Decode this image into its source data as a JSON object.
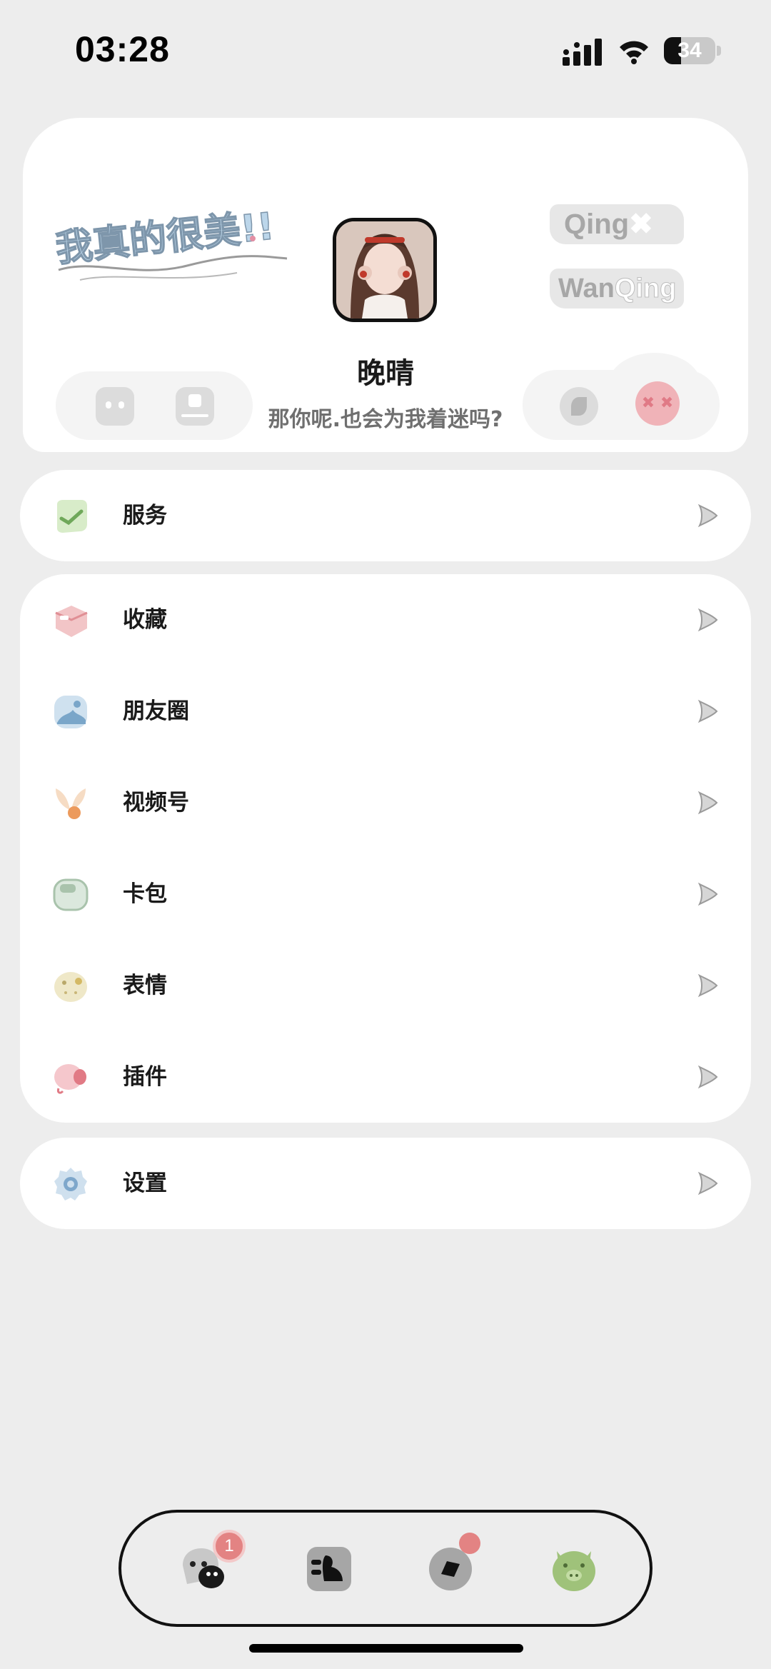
{
  "status_bar": {
    "time": "03:28",
    "battery_percent": "34"
  },
  "profile": {
    "sticker_text": "我真的很美!!",
    "name": "晚晴",
    "signature": "那你呢.也会为我着迷吗?",
    "tags": [
      {
        "text": "Qing"
      },
      {
        "text_a": "Wan",
        "text_b": "Qing"
      }
    ]
  },
  "menu": {
    "services": {
      "label": "服务",
      "icon": "check-leaf-icon"
    },
    "group": [
      {
        "label": "收藏",
        "icon": "favorites-cube-icon"
      },
      {
        "label": "朋友圈",
        "icon": "moments-landscape-icon"
      },
      {
        "label": "视频号",
        "icon": "channels-bow-icon"
      },
      {
        "label": "卡包",
        "icon": "wallet-icon"
      },
      {
        "label": "表情",
        "icon": "sticker-face-icon"
      },
      {
        "label": "插件",
        "icon": "plugin-pig-icon"
      }
    ],
    "settings": {
      "label": "设置",
      "icon": "gear-icon"
    }
  },
  "bottom_nav": {
    "items": [
      {
        "name": "chats",
        "icon": "chat-blob-icon"
      },
      {
        "name": "contacts",
        "icon": "contacts-card-icon"
      },
      {
        "name": "discover",
        "icon": "discover-compass-icon"
      },
      {
        "name": "me",
        "icon": "pig-face-icon"
      }
    ],
    "chat_badge": "1"
  },
  "colors": {
    "background": "#ededed",
    "card": "#ffffff",
    "badge": "#e38383",
    "nav_active": "#9fc27a"
  }
}
